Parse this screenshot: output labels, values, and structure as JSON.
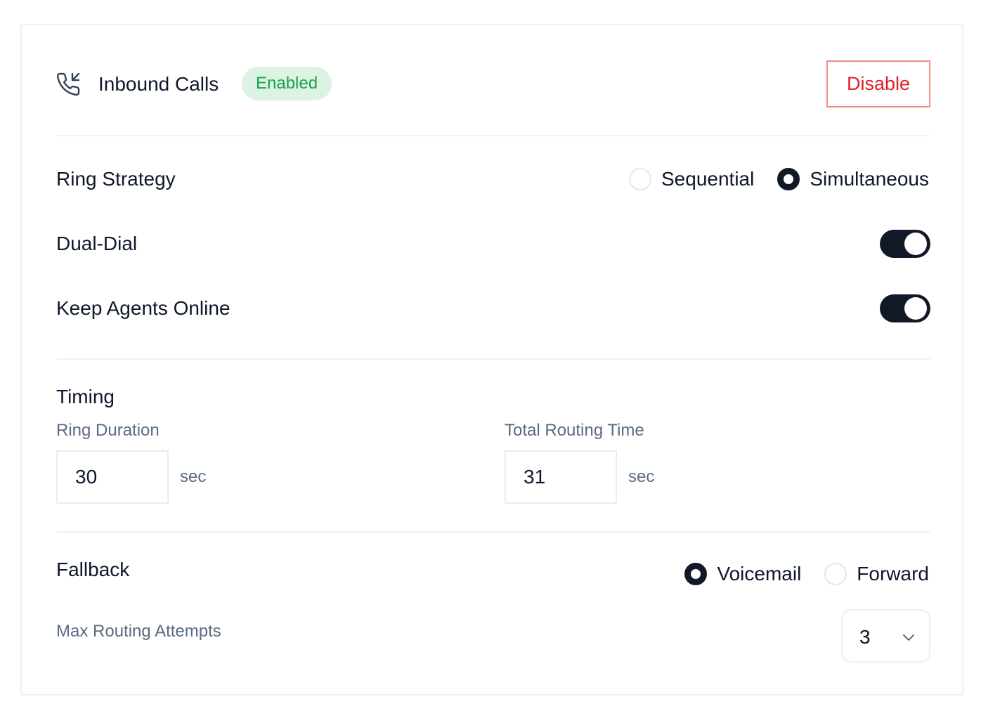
{
  "header": {
    "title": "Inbound Calls",
    "status_badge": "Enabled",
    "disable_label": "Disable"
  },
  "ring_strategy": {
    "label": "Ring Strategy",
    "options": [
      "Sequential",
      "Simultaneous"
    ],
    "selected": "Simultaneous"
  },
  "dual_dial": {
    "label": "Dual-Dial",
    "on": true
  },
  "keep_agents_online": {
    "label": "Keep Agents Online",
    "on": true
  },
  "timing": {
    "heading": "Timing",
    "ring_duration": {
      "label": "Ring Duration",
      "value": "30",
      "unit": "sec"
    },
    "total_routing_time": {
      "label": "Total Routing Time",
      "value": "31",
      "unit": "sec"
    }
  },
  "fallback": {
    "label": "Fallback",
    "options": [
      "Voicemail",
      "Forward"
    ],
    "selected": "Voicemail"
  },
  "max_routing_attempts": {
    "label": "Max Routing Attempts",
    "value": "3"
  },
  "colors": {
    "badge_bg": "#dcf3e3",
    "badge_text": "#15a34a",
    "danger": "#e11d2a",
    "toggle_on": "#111827"
  },
  "icons": {
    "header": "phone-incoming-icon",
    "select": "chevron-down-icon"
  }
}
